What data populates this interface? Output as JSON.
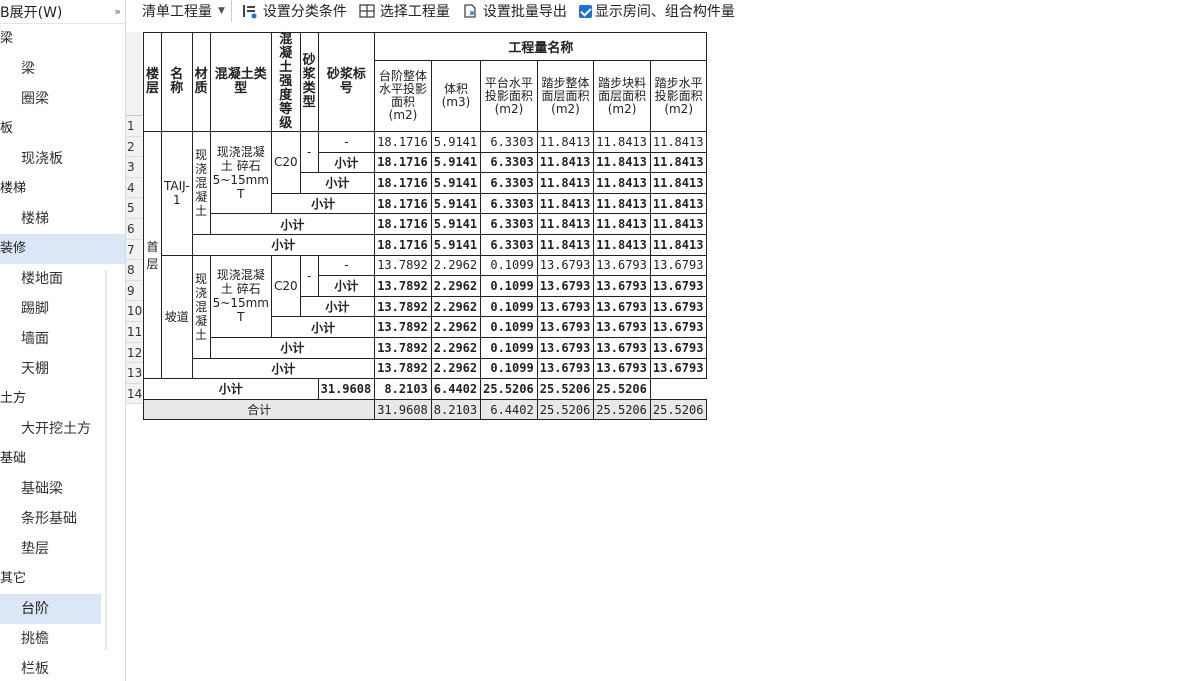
{
  "sidebar": {
    "header": "B展开(W)",
    "header_chevron": "»",
    "groups": [
      {
        "label": "梁",
        "items": [
          "梁",
          "圈梁"
        ]
      },
      {
        "label": "板",
        "items": [
          "现浇板"
        ]
      },
      {
        "label": "楼梯",
        "items": [
          "楼梯"
        ]
      },
      {
        "label": "装修",
        "items": [
          "楼地面",
          "踢脚",
          "墙面",
          "天棚"
        ],
        "active": true
      },
      {
        "label": "土方",
        "items": [
          "大开挖土方"
        ]
      },
      {
        "label": "基础",
        "items": [
          "基础梁",
          "条形基础",
          "垫层"
        ]
      },
      {
        "label": "其它",
        "items": [
          "台阶",
          "挑檐",
          "栏板"
        ],
        "selected_item": "台阶"
      }
    ]
  },
  "toolbar": {
    "mode_select": "清单工程量",
    "set_category": "设置分类条件",
    "select_project": "选择工程量",
    "batch_export": "设置批量导出",
    "show_rooms": "显示房间、组合构件量",
    "show_rooms_checked": true
  },
  "table": {
    "headers": {
      "floor": "楼层",
      "name": "名称",
      "material": "材质",
      "concrete_type": "混凝土类型",
      "concrete_grade": "混凝土强度等级",
      "mortar_type": "砂浆类型",
      "mortar_grade": "砂浆标号",
      "qty_group": "工程量名称",
      "qty_cols": [
        "台阶整体水平投影面积(m2)",
        "体积(m3)",
        "平台水平投影面积(m2)",
        "踏步整体面层面积(m2)",
        "踏步块料面层面积(m2)",
        "踏步水平投影面积(m2)"
      ]
    },
    "floor": "首层",
    "items": [
      {
        "name": "TAIJ-1",
        "material": "现浇混凝土",
        "concrete_type": "现浇混凝土  碎石5~15mm T",
        "grade": "C20",
        "mortar_type": "-",
        "mortar_grade": "-",
        "subtotal_label": "小计",
        "values": [
          "18.1716",
          "5.9141",
          "6.3303",
          "11.8413",
          "11.8413",
          "11.8413"
        ]
      },
      {
        "name": "坡道",
        "material": "现浇混凝土",
        "concrete_type": "现浇混凝土  碎石5~15mm T",
        "grade": "C20",
        "mortar_type": "-",
        "mortar_grade": "-",
        "subtotal_label": "小计",
        "values": [
          "13.7892",
          "2.2962",
          "0.1099",
          "13.6793",
          "13.6793",
          "13.6793"
        ]
      }
    ],
    "floor_subtotal_label": "小计",
    "floor_subtotal": [
      "31.9608",
      "8.2103",
      "6.4402",
      "25.5206",
      "25.5206",
      "25.5206"
    ],
    "total_label": "合计",
    "total": [
      "31.9608",
      "8.2103",
      "6.4402",
      "25.5206",
      "25.5206",
      "25.5206"
    ],
    "row_numbers": [
      "1",
      "2",
      "3",
      "4",
      "5",
      "6",
      "7",
      "8",
      "9",
      "10",
      "11",
      "12",
      "13",
      "14"
    ]
  }
}
